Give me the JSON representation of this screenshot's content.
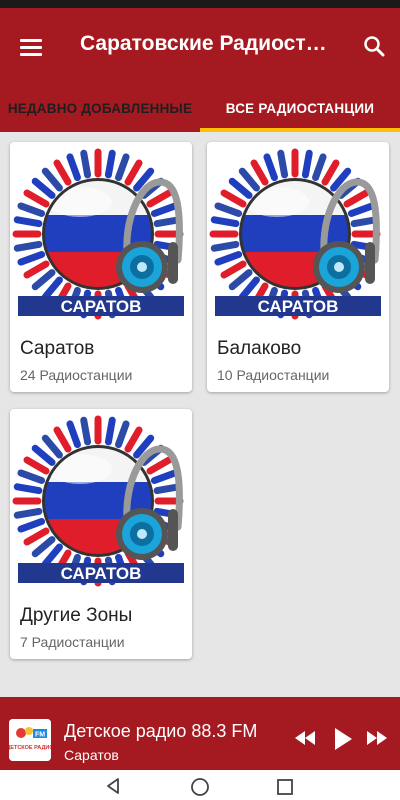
{
  "app": {
    "title": "Саратовские Радиостанции",
    "brand_color": "#a51a20",
    "accent_color": "#ffc107"
  },
  "tabs": [
    {
      "label": "НЕДАВНО ДОБАВЛЕННЫЕ",
      "selected": false
    },
    {
      "label": "ВСЕ РАДИОСТАНЦИИ",
      "selected": true
    }
  ],
  "cards": [
    {
      "title": "Саратов",
      "subtitle": "24 Радиостанции",
      "banner": "САРАТОВ"
    },
    {
      "title": "Балаково",
      "subtitle": "10 Радиостанции",
      "banner": "САРАТОВ"
    },
    {
      "title": "Другие Зоны",
      "subtitle": "7 Радиостанции",
      "banner": "САРАТОВ"
    }
  ],
  "player": {
    "title": "Детское радио 88.3 FM",
    "subtitle": "Саратов",
    "logo_text": "ДЕТСКОЕ РАДИО"
  },
  "icons": {
    "menu": "menu-icon",
    "search": "search-icon",
    "rewind": "rewind-icon",
    "play": "play-icon",
    "forward": "fast-forward-icon",
    "back": "back-icon",
    "home": "home-icon",
    "recents": "recents-icon"
  }
}
